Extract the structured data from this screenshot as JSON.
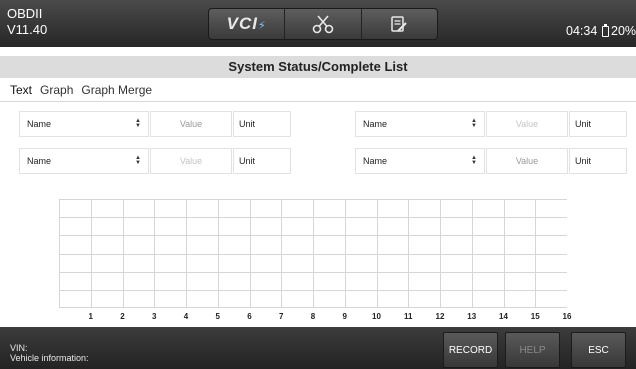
{
  "header": {
    "app_name": "OBDII",
    "version": "V11.40",
    "vci_label": "VCI",
    "vci_icon": "vci-connection-icon",
    "scissors_icon": "scissors-icon",
    "report_icon": "report-edit-icon",
    "time": "04:34",
    "battery": "20%"
  },
  "title": "System Status/Complete List",
  "tabs": [
    "Text",
    "Graph",
    "Graph Merge"
  ],
  "selectors": [
    {
      "name": "Name",
      "value": "Value",
      "unit": "Unit"
    },
    {
      "name": "Name",
      "value": "Value",
      "unit": "Unit"
    },
    {
      "name": "Name",
      "value": "Value",
      "unit": "Unit"
    },
    {
      "name": "Name",
      "value": "Value",
      "unit": "Unit"
    }
  ],
  "chart_data": {
    "type": "line",
    "x": [
      1,
      2,
      3,
      4,
      5,
      6,
      7,
      8,
      9,
      10,
      11,
      12,
      13,
      14,
      15,
      16
    ],
    "tick_labels": [
      "1",
      "2",
      "3",
      "4",
      "5",
      "6",
      "7",
      "8",
      "9",
      "10",
      "11",
      "12",
      "13",
      "14",
      "15",
      "16"
    ],
    "series": [],
    "grid": true,
    "xlim": [
      0,
      16
    ]
  },
  "footer": {
    "vin_label": "VIN:",
    "vehicle_info_label": "Vehicle information:",
    "buttons": {
      "record": "RECORD",
      "help": "HELP",
      "esc": "ESC"
    }
  },
  "colors": {
    "grid": "#d6d6d6",
    "toolbar": "#2e2e2e",
    "vci_accent": "#7ec8ff"
  }
}
